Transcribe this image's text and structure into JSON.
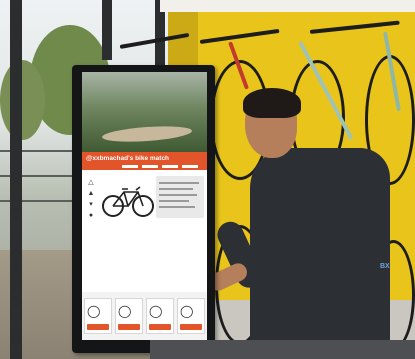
{
  "kiosk": {
    "title": "@xxbmachad's bike match"
  },
  "scene": {
    "brand_mark": "BX"
  },
  "colors": {
    "accent": "#e2542a",
    "wall": "#e9c51c",
    "kiosk_bezel": "#141516"
  },
  "icons": [
    "bike-icon",
    "compare-icon",
    "filter-icon",
    "settings-icon"
  ]
}
